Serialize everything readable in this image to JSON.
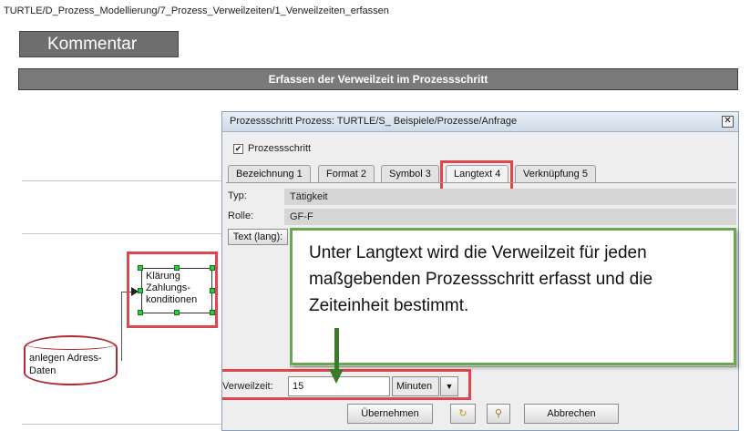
{
  "breadcrumb": "TURTLE/D_Prozess_Modellierung/7_Prozess_Verweilzeiten/1_Verweilzeiten_erfassen",
  "comment_button": "Kommentar",
  "section_title": "Erfassen der Verweilzeit im Prozessschritt",
  "diagram": {
    "node_klaerung": [
      "Klärung",
      "Zahlungs-",
      "konditionen"
    ],
    "node_anlegen": [
      "anlegen Adress-",
      "Daten"
    ]
  },
  "dialog": {
    "title": "Prozessschritt Prozess: TURTLE/S_ Beispiele/Prozesse/Anfrage",
    "close_icon": "✕",
    "checkbox_label": "Prozessschritt",
    "checkbox_checked": "✔",
    "tabs": [
      {
        "label": "Bezeichnung 1"
      },
      {
        "label": "Format 2"
      },
      {
        "label": "Symbol 3"
      },
      {
        "label": "Langtext 4"
      },
      {
        "label": "Verknüpfung 5"
      }
    ],
    "fields": {
      "typ_label": "Typ:",
      "typ_value": "Tätigkeit",
      "rolle_label": "Rolle:",
      "rolle_value": "GF-F",
      "text_button": "Text (lang):"
    },
    "verweilzeit": {
      "label": "Verweilzeit:",
      "value": "15",
      "unit": "Minuten",
      "dropdown_icon": "▼"
    },
    "buttons": {
      "apply": "Übernehmen",
      "cancel": "Abbrechen",
      "refresh_icon": "↻",
      "attach_icon": "⚲"
    }
  },
  "callout": {
    "text": "Unter Langtext wird die Verweilzeit für jeden maßgebenden Prozessschritt erfasst und die Zeiteinheit bestimmt."
  },
  "colors": {
    "highlight_red": "#e0474c",
    "callout_green": "#6aa84f",
    "handle_green": "#2ecc40",
    "bar_gray": "#7a7a7a"
  }
}
